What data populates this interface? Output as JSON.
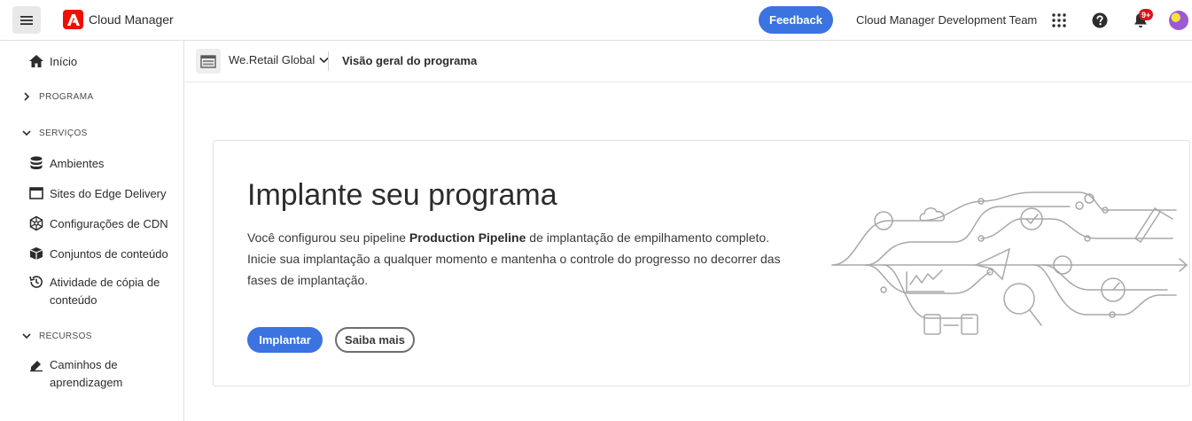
{
  "header": {
    "brand": "Cloud Manager",
    "feedback_label": "Feedback",
    "org_name": "Cloud Manager Development Team",
    "notification_badge": "9+",
    "brand_color": "#eb1000",
    "accent_color": "#3b73e0"
  },
  "sidebar": {
    "home": "Início",
    "program_section": "PROGRAMA",
    "services_section": "SERVIÇOS",
    "services": [
      {
        "label": "Ambientes",
        "icon": "database-icon"
      },
      {
        "label": "Sites do Edge Delivery",
        "icon": "browser-window-icon"
      },
      {
        "label": "Configurações de CDN",
        "icon": "cdn-network-icon"
      },
      {
        "label": "Conjuntos de conteúdo",
        "icon": "box-icon"
      },
      {
        "label_line1": "Atividade de cópia de",
        "label_line2": "conteúdo",
        "icon": "history-icon"
      }
    ],
    "resources_section": "RECURSOS",
    "resources": [
      {
        "label_line1": "Caminhos de",
        "label_line2": "aprendizagem",
        "icon": "learn-icon"
      }
    ]
  },
  "breadcrumb": {
    "program": "We.Retail Global",
    "page": "Visão geral do programa"
  },
  "card": {
    "title": "Implante seu programa",
    "desc_part1": "Você configurou seu pipeline ",
    "pipeline_name": "Production Pipeline",
    "desc_part2": " de implantação de empilhamento completo. Inicie sua implantação a qualquer momento e mantenha o controle do progresso no decorrer das fases de implantação.",
    "primary_button": "Implantar",
    "secondary_button": "Saiba mais"
  }
}
